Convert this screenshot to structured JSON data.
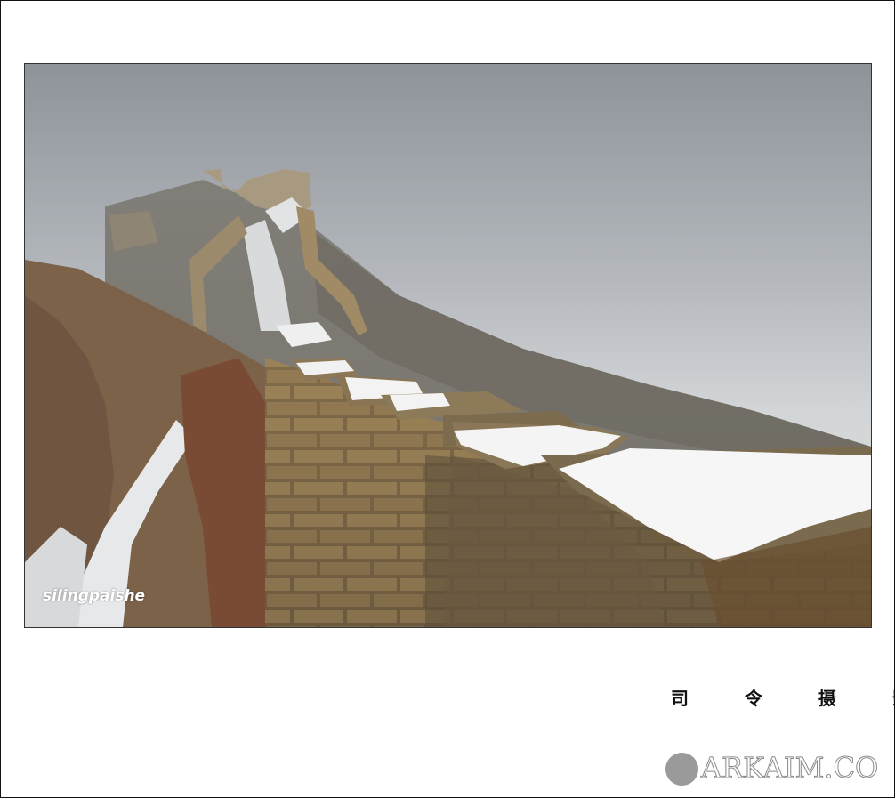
{
  "photo": {
    "subject": "",
    "corner_watermark": "silingpaishe"
  },
  "signature": "司 令 摄 影",
  "site_logo": "ARKAIM.CO"
}
